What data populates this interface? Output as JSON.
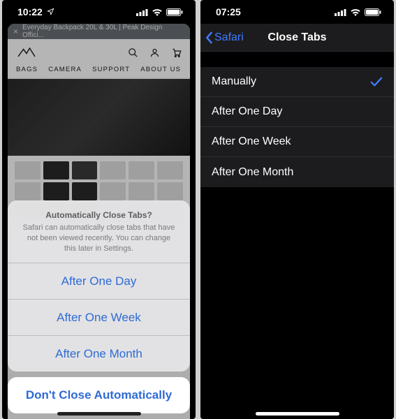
{
  "left": {
    "status_time": "10:22",
    "tab_title": "Everyday Backpack 20L & 30L | Peak Design Offici...",
    "nav": {
      "item0": "BAGS",
      "item1": "CAMERA",
      "item2": "SUPPORT",
      "item3": "ABOUT US"
    },
    "sheet": {
      "title": "Automatically Close Tabs?",
      "message": "Safari can automatically close tabs that have not been viewed recently. You can change this later in Settings.",
      "opt0": "After One Day",
      "opt1": "After One Week",
      "opt2": "After One Month",
      "cancel": "Don't Close Automatically"
    }
  },
  "right": {
    "status_time": "07:25",
    "back_label": "Safari",
    "title": "Close Tabs",
    "row0": "Manually",
    "row1": "After One Day",
    "row2": "After One Week",
    "row3": "After One Month",
    "selected_index": 0
  }
}
